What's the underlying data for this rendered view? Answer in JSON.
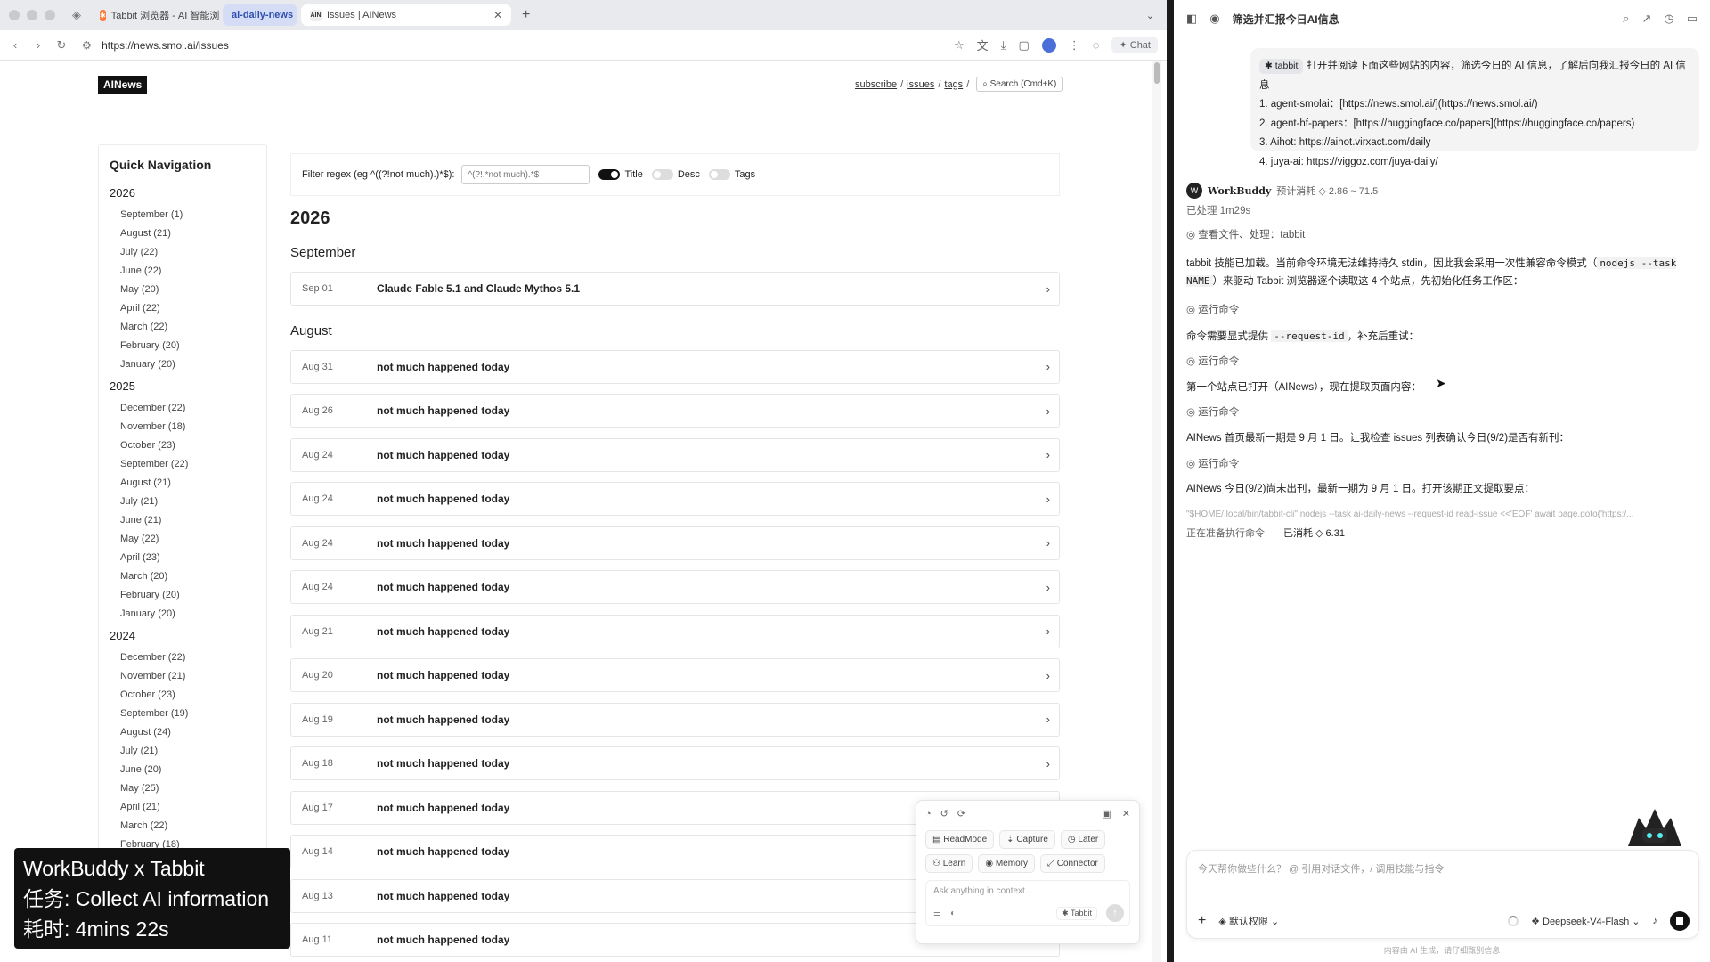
{
  "browser": {
    "tabs": [
      {
        "label": "Tabbit 浏览器 - AI 智能浏览器"
      },
      {
        "label": "ai-daily-news"
      },
      {
        "label": "Issues | AINews"
      }
    ],
    "url": "https://news.smol.ai/issues",
    "chat_label": "Chat"
  },
  "site": {
    "logo": "AINews",
    "nav": {
      "subscribe": "subscribe",
      "issues": "issues",
      "tags": "tags",
      "search": "Search (Cmd+K)",
      "sep": "/"
    },
    "quicknav": {
      "title": "Quick Navigation",
      "years": [
        {
          "year": "2026",
          "months": [
            "September (1)",
            "August (21)",
            "July (22)",
            "June (22)",
            "May (20)",
            "April (22)",
            "March (22)",
            "February (20)",
            "January (20)"
          ]
        },
        {
          "year": "2025",
          "months": [
            "December (22)",
            "November (18)",
            "October (23)",
            "September (22)",
            "August (21)",
            "July (21)",
            "June (21)",
            "May (22)",
            "April (23)",
            "March (20)",
            "February (20)",
            "January (20)"
          ]
        },
        {
          "year": "2024",
          "months": [
            "December (22)",
            "November (21)",
            "October (23)",
            "September (19)",
            "August (24)",
            "July (21)",
            "June (20)",
            "May (25)",
            "April (21)",
            "March (22)",
            "February (18)"
          ]
        }
      ]
    },
    "filter": {
      "label": "Filter regex (eg ^((?!not much).)*$):",
      "placeholder": "^(?!.*not much).*$",
      "title_label": "Title",
      "desc_label": "Desc",
      "tags_label": "Tags"
    },
    "year_heading": "2026",
    "sections": [
      {
        "month": "September",
        "issues": [
          {
            "date": "Sep 01",
            "title": "Claude Fable 5.1 and Claude Mythos 5.1"
          }
        ]
      },
      {
        "month": "August",
        "issues": [
          {
            "date": "Aug 31",
            "title": "not much happened today"
          },
          {
            "date": "Aug 26",
            "title": "not much happened today"
          },
          {
            "date": "Aug 24",
            "title": "not much happened today"
          },
          {
            "date": "Aug 24",
            "title": "not much happened today"
          },
          {
            "date": "Aug 24",
            "title": "not much happened today"
          },
          {
            "date": "Aug 24",
            "title": "not much happened today"
          },
          {
            "date": "Aug 21",
            "title": "not much happened today"
          },
          {
            "date": "Aug 20",
            "title": "not much happened today"
          },
          {
            "date": "Aug 19",
            "title": "not much happened today"
          },
          {
            "date": "Aug 18",
            "title": "not much happened today"
          },
          {
            "date": "Aug 17",
            "title": "not much happened today"
          },
          {
            "date": "Aug 14",
            "title": "not much happened today"
          },
          {
            "date": "Aug 13",
            "title": "not much happened today"
          },
          {
            "date": "Aug 11",
            "title": "not much happened today"
          }
        ]
      }
    ]
  },
  "caption": {
    "line1": "WorkBuddy x Tabbit",
    "line2": "任务: Collect AI information",
    "line3": "耗时: 4mins 22s"
  },
  "mini": {
    "chips": [
      "ReadMode",
      "Capture",
      "Later",
      "Learn",
      "Memory",
      "Connector"
    ],
    "placeholder": "Ask anything in context...",
    "tabbit": "Tabbit"
  },
  "panel": {
    "title": "筛选并汇报今日AI信息",
    "user_tag": "tabbit",
    "user_lines": [
      "打开并阅读下面这些网站的内容，筛选今日的 AI 信息，了解后向我汇报今日的 AI 信息",
      "1. agent-smolai：[https://news.smol.ai/](https://news.smol.ai/)",
      "2. agent-hf-papers：[https://huggingface.co/papers](https://huggingface.co/papers)",
      "3. Aihot: https://aihot.virxact.com/daily",
      "4. juya-ai: https://viggoz.com/juya-daily/"
    ],
    "agent_name": "WorkBuddy",
    "cost_est": "预计消耗 ◇ 2.86 ~ 71.5",
    "processed": "已处理 1m29s",
    "tool_view": "查看文件、处理：tabbit",
    "msg1_a": "tabbit 技能已加载。当前命令环境无法维持持久 stdin，因此我会采用一次性兼容命令模式（",
    "msg1_code": "nodejs --task NAME",
    "msg1_b": "）来驱动 Tabbit 浏览器逐个读取这 4 个站点，先初始化任务工作区：",
    "run_cmd": "运行命令",
    "msg2_a": "命令需要显式提供 ",
    "msg2_code": "--request-id",
    "msg2_b": "，补充后重试：",
    "msg3": "第一个站点已打开（AINews），现在提取页面内容：",
    "msg4": "AINews 首页最新一期是 9 月 1 日。让我检查 issues 列表确认今日(9/2)是否有新刊：",
    "msg5": "AINews 今日(9/2)尚未出刊，最新一期为 9 月 1 日。打开该期正文提取要点：",
    "faded_cmd": "\"$HOME/.local/bin/tabbit-cli\" nodejs --task ai-daily-news --request-id read-issue <<'EOF' await page.goto('https:/...",
    "status_pending": "正在准备执行命令",
    "status_used": "已消耗 ◇ 6.31",
    "composer_placeholder": "今天帮你做些什么？ @ 引用对话文件，/ 调用技能与指令",
    "permission": "默认权限",
    "model": "Deepseek-V4-Flash",
    "footer": "内容由 AI 生成，请仔细甄别信息"
  },
  "colors": {
    "accent": "#2f4fb0",
    "dark": "#111111",
    "border": "#e5e5e5"
  }
}
